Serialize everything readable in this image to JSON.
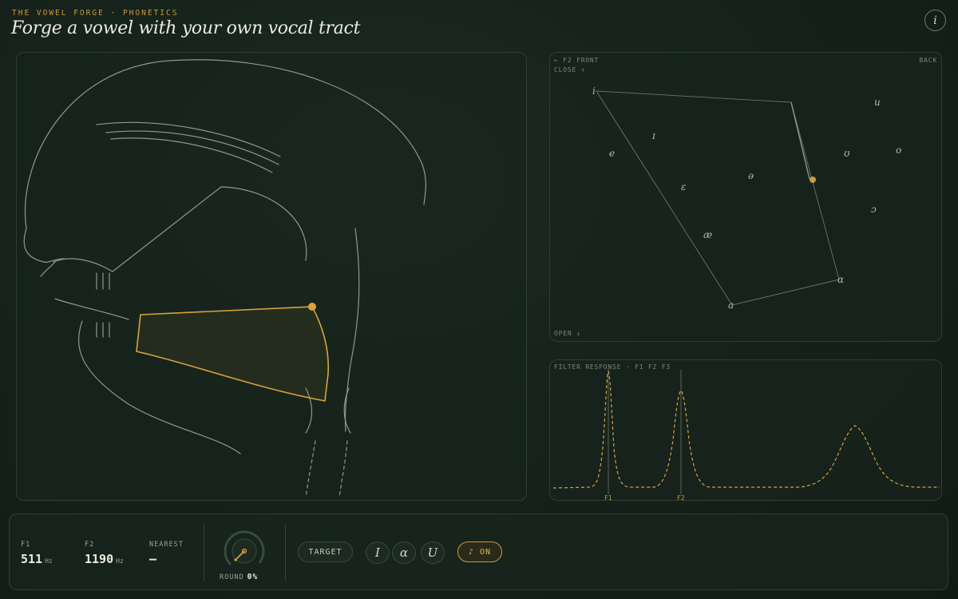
{
  "header": {
    "eyebrow": "THE VOWEL FORGE · PHONETICS",
    "title": "Forge a vowel with your own vocal tract",
    "info_icon": "info-icon",
    "info_glyph": "i"
  },
  "vowel_chart": {
    "top_left_label": "← F2  FRONT",
    "top_right_label": "BACK",
    "close_label": "CLOSE ↑",
    "open_label": "OPEN ↓",
    "vowels": [
      "i",
      "ɪ",
      "e",
      "ɛ",
      "æ",
      "ə",
      "u",
      "ʊ",
      "o",
      "ɔ",
      "ɑ",
      "a"
    ]
  },
  "filter": {
    "title": "FILTER RESPONSE · F1 F2 F3",
    "f1_label": "F1",
    "f2_label": "F2"
  },
  "controls": {
    "f1": {
      "label": "F1",
      "value": "511",
      "unit": "Hz"
    },
    "f2": {
      "label": "F2",
      "value": "1190",
      "unit": "Hz"
    },
    "nearest": {
      "label": "NEAREST",
      "value": "—"
    },
    "round": {
      "label": "ROUND",
      "value": "0%",
      "fraction": 0
    },
    "target_label": "TARGET",
    "presets": [
      "I",
      "ɑ",
      "U"
    ],
    "sound_label": "♪ ON"
  },
  "colors": {
    "accent": "#d9a23c",
    "line": "#8f9a8c",
    "background": "#142019"
  }
}
